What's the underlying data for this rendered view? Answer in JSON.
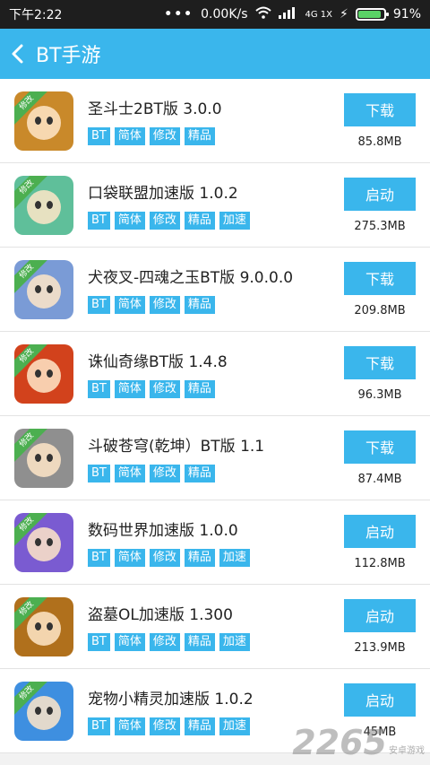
{
  "status_bar": {
    "time": "下午2:22",
    "dots": "•••",
    "speed": "0.00K/s",
    "signal_label": "4G 1X",
    "battery": "91%",
    "battery_level": 0.91
  },
  "header": {
    "title": "BT手游"
  },
  "games": [
    {
      "name": "圣斗士2BT版 3.0.0",
      "tags": [
        "BT",
        "简体",
        "修改",
        "精品"
      ],
      "button": "下载",
      "size": "85.8MB",
      "ribbon": "修改",
      "icon_color": "#c9892a"
    },
    {
      "name": "口袋联盟加速版 1.0.2",
      "tags": [
        "BT",
        "简体",
        "修改",
        "精品",
        "加速"
      ],
      "button": "启动",
      "size": "275.3MB",
      "ribbon": "修改",
      "icon_color": "#5fbf9a"
    },
    {
      "name": "犬夜叉-四魂之玉BT版 9.0.0.0",
      "tags": [
        "BT",
        "简体",
        "修改",
        "精品"
      ],
      "button": "下载",
      "size": "209.8MB",
      "ribbon": "修改",
      "icon_color": "#7a9bd6"
    },
    {
      "name": "诛仙奇缘BT版 1.4.8",
      "tags": [
        "BT",
        "简体",
        "修改",
        "精品"
      ],
      "button": "下载",
      "size": "96.3MB",
      "ribbon": "修改",
      "icon_color": "#d2421c"
    },
    {
      "name": "斗破苍穹(乾坤）BT版 1.1",
      "tags": [
        "BT",
        "简体",
        "修改",
        "精品"
      ],
      "button": "下载",
      "size": "87.4MB",
      "ribbon": "修改",
      "icon_color": "#8f8f8f"
    },
    {
      "name": "数码世界加速版 1.0.0",
      "tags": [
        "BT",
        "简体",
        "修改",
        "精品",
        "加速"
      ],
      "button": "启动",
      "size": "112.8MB",
      "ribbon": "修改",
      "icon_color": "#7a5bd1"
    },
    {
      "name": "盗墓OL加速版 1.300",
      "tags": [
        "BT",
        "简体",
        "修改",
        "精品",
        "加速"
      ],
      "button": "启动",
      "size": "213.9MB",
      "ribbon": "修改",
      "icon_color": "#b0701c"
    },
    {
      "name": "宠物小精灵加速版 1.0.2",
      "tags": [
        "BT",
        "简体",
        "修改",
        "精品",
        "加速"
      ],
      "button": "启动",
      "size": "45MB",
      "ribbon": "修改",
      "icon_color": "#3e8fe0"
    }
  ],
  "watermark": {
    "number": "2265",
    "text": "安卓游戏"
  },
  "colors": {
    "accent": "#3ab6ec",
    "status_bg": "#1e1e1e",
    "ribbon": "#4caf50"
  }
}
